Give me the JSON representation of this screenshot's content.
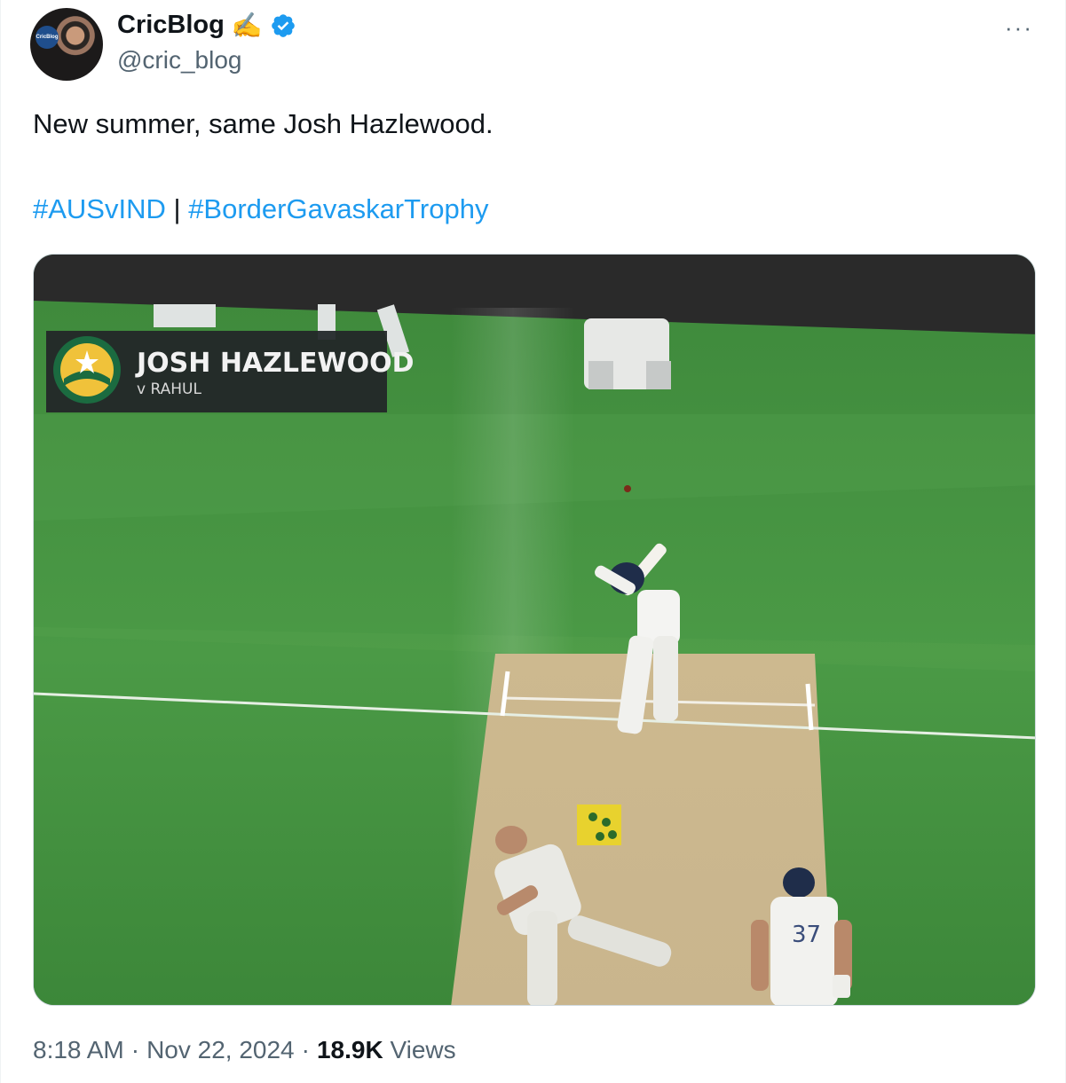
{
  "author": {
    "display_name": "CricBlog",
    "emoji": "✍️",
    "handle": "@cric_blog",
    "avatar_logo_text": "CricBlog",
    "verified": true
  },
  "more_label": "···",
  "tweet": {
    "text": "New summer, same Josh Hazlewood.",
    "hashtag_1": "#AUSvIND",
    "separator": "|",
    "hashtag_2": "#BorderGavaskarTrophy"
  },
  "media": {
    "graphic_name": "JOSH HAZLEWOOD",
    "graphic_sub": "v RAHUL",
    "jersey_number": "37"
  },
  "meta": {
    "time": "8:18 AM",
    "dot1": "·",
    "date": "Nov 22, 2024",
    "dot2": "·",
    "views_count": "18.9K",
    "views_label": "Views"
  },
  "colors": {
    "link": "#1d9bf0",
    "verified": "#1d9bf0",
    "secondary_text": "#536471"
  }
}
